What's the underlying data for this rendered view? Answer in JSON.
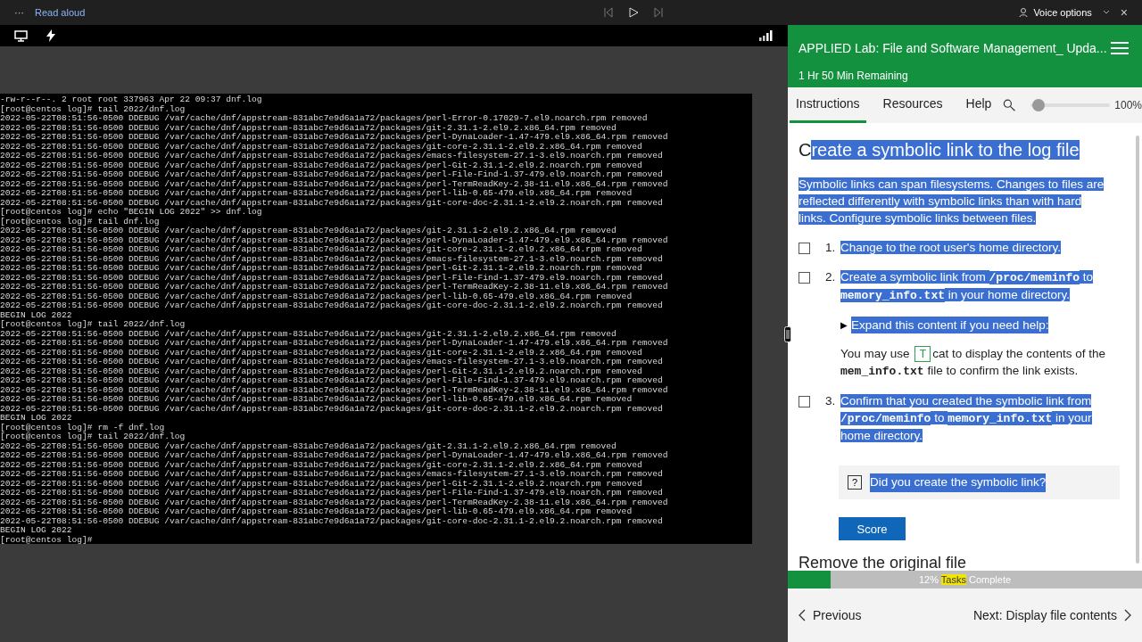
{
  "top_bar": {
    "more": "···",
    "read_aloud": "Read aloud",
    "voice_options": "Voice options",
    "close": "×"
  },
  "terminal": {
    "lines": [
      "-rw-r--r--. 2 root root 337963 Apr 22 09:37 dnf.log",
      "[root@centos log]# tail 2022/dnf.log",
      "2022-05-22T08:51:56-0500 DDEBUG /var/cache/dnf/appstream-831abc7e9d6a1a72/packages/perl-Error-0.17029-7.el9.noarch.rpm removed",
      "2022-05-22T08:51:56-0500 DDEBUG /var/cache/dnf/appstream-831abc7e9d6a1a72/packages/git-2.31.1-2.el9.2.x86_64.rpm removed",
      "2022-05-22T08:51:56-0500 DDEBUG /var/cache/dnf/appstream-831abc7e9d6a1a72/packages/perl-DynaLoader-1.47-479.el9.x86_64.rpm removed",
      "2022-05-22T08:51:56-0500 DDEBUG /var/cache/dnf/appstream-831abc7e9d6a1a72/packages/git-core-2.31.1-2.el9.2.x86_64.rpm removed",
      "2022-05-22T08:51:56-0500 DDEBUG /var/cache/dnf/appstream-831abc7e9d6a1a72/packages/emacs-filesystem-27.1-3.el9.noarch.rpm removed",
      "2022-05-22T08:51:56-0500 DDEBUG /var/cache/dnf/appstream-831abc7e9d6a1a72/packages/perl-Git-2.31.1-2.el9.2.noarch.rpm removed",
      "2022-05-22T08:51:56-0500 DDEBUG /var/cache/dnf/appstream-831abc7e9d6a1a72/packages/perl-File-Find-1.37-479.el9.noarch.rpm removed",
      "2022-05-22T08:51:56-0500 DDEBUG /var/cache/dnf/appstream-831abc7e9d6a1a72/packages/perl-TermReadKey-2.38-11.el9.x86_64.rpm removed",
      "2022-05-22T08:51:56-0500 DDEBUG /var/cache/dnf/appstream-831abc7e9d6a1a72/packages/perl-lib-0.65-479.el9.x86_64.rpm removed",
      "2022-05-22T08:51:56-0500 DDEBUG /var/cache/dnf/appstream-831abc7e9d6a1a72/packages/git-core-doc-2.31.1-2.el9.2.noarch.rpm removed",
      "[root@centos log]# echo \"BEGIN LOG 2022\" >> dnf.log",
      "[root@centos log]# tail dnf.log",
      "2022-05-22T08:51:56-0500 DDEBUG /var/cache/dnf/appstream-831abc7e9d6a1a72/packages/git-2.31.1-2.el9.2.x86_64.rpm removed",
      "2022-05-22T08:51:56-0500 DDEBUG /var/cache/dnf/appstream-831abc7e9d6a1a72/packages/perl-DynaLoader-1.47-479.el9.x86_64.rpm removed",
      "2022-05-22T08:51:56-0500 DDEBUG /var/cache/dnf/appstream-831abc7e9d6a1a72/packages/git-core-2.31.1-2.el9.2.x86_64.rpm removed",
      "2022-05-22T08:51:56-0500 DDEBUG /var/cache/dnf/appstream-831abc7e9d6a1a72/packages/emacs-filesystem-27.1-3.el9.noarch.rpm removed",
      "2022-05-22T08:51:56-0500 DDEBUG /var/cache/dnf/appstream-831abc7e9d6a1a72/packages/perl-Git-2.31.1-2.el9.2.noarch.rpm removed",
      "2022-05-22T08:51:56-0500 DDEBUG /var/cache/dnf/appstream-831abc7e9d6a1a72/packages/perl-File-Find-1.37-479.el9.noarch.rpm removed",
      "2022-05-22T08:51:56-0500 DDEBUG /var/cache/dnf/appstream-831abc7e9d6a1a72/packages/perl-TermReadKey-2.38-11.el9.x86_64.rpm removed",
      "2022-05-22T08:51:56-0500 DDEBUG /var/cache/dnf/appstream-831abc7e9d6a1a72/packages/perl-lib-0.65-479.el9.x86_64.rpm removed",
      "2022-05-22T08:51:56-0500 DDEBUG /var/cache/dnf/appstream-831abc7e9d6a1a72/packages/git-core-doc-2.31.1-2.el9.2.noarch.rpm removed",
      "BEGIN LOG 2022",
      "[root@centos log]# tail 2022/dnf.log",
      "2022-05-22T08:51:56-0500 DDEBUG /var/cache/dnf/appstream-831abc7e9d6a1a72/packages/git-2.31.1-2.el9.2.x86_64.rpm removed",
      "2022-05-22T08:51:56-0500 DDEBUG /var/cache/dnf/appstream-831abc7e9d6a1a72/packages/perl-DynaLoader-1.47-479.el9.x86_64.rpm removed",
      "2022-05-22T08:51:56-0500 DDEBUG /var/cache/dnf/appstream-831abc7e9d6a1a72/packages/git-core-2.31.1-2.el9.2.x86_64.rpm removed",
      "2022-05-22T08:51:56-0500 DDEBUG /var/cache/dnf/appstream-831abc7e9d6a1a72/packages/emacs-filesystem-27.1-3.el9.noarch.rpm removed",
      "2022-05-22T08:51:56-0500 DDEBUG /var/cache/dnf/appstream-831abc7e9d6a1a72/packages/perl-Git-2.31.1-2.el9.2.noarch.rpm removed",
      "2022-05-22T08:51:56-0500 DDEBUG /var/cache/dnf/appstream-831abc7e9d6a1a72/packages/perl-File-Find-1.37-479.el9.noarch.rpm removed",
      "2022-05-22T08:51:56-0500 DDEBUG /var/cache/dnf/appstream-831abc7e9d6a1a72/packages/perl-TermReadKey-2.38-11.el9.x86_64.rpm removed",
      "2022-05-22T08:51:56-0500 DDEBUG /var/cache/dnf/appstream-831abc7e9d6a1a72/packages/perl-lib-0.65-479.el9.x86_64.rpm removed",
      "2022-05-22T08:51:56-0500 DDEBUG /var/cache/dnf/appstream-831abc7e9d6a1a72/packages/git-core-doc-2.31.1-2.el9.2.noarch.rpm removed",
      "BEGIN LOG 2022",
      "[root@centos log]# rm -f dnf.log",
      "[root@centos log]# tail 2022/dnf.log",
      "2022-05-22T08:51:56-0500 DDEBUG /var/cache/dnf/appstream-831abc7e9d6a1a72/packages/git-2.31.1-2.el9.2.x86_64.rpm removed",
      "2022-05-22T08:51:56-0500 DDEBUG /var/cache/dnf/appstream-831abc7e9d6a1a72/packages/perl-DynaLoader-1.47-479.el9.x86_64.rpm removed",
      "2022-05-22T08:51:56-0500 DDEBUG /var/cache/dnf/appstream-831abc7e9d6a1a72/packages/git-core-2.31.1-2.el9.2.x86_64.rpm removed",
      "2022-05-22T08:51:56-0500 DDEBUG /var/cache/dnf/appstream-831abc7e9d6a1a72/packages/emacs-filesystem-27.1-3.el9.noarch.rpm removed",
      "2022-05-22T08:51:56-0500 DDEBUG /var/cache/dnf/appstream-831abc7e9d6a1a72/packages/perl-Git-2.31.1-2.el9.2.noarch.rpm removed",
      "2022-05-22T08:51:56-0500 DDEBUG /var/cache/dnf/appstream-831abc7e9d6a1a72/packages/perl-File-Find-1.37-479.el9.noarch.rpm removed",
      "2022-05-22T08:51:56-0500 DDEBUG /var/cache/dnf/appstream-831abc7e9d6a1a72/packages/perl-TermReadKey-2.38-11.el9.x86_64.rpm removed",
      "2022-05-22T08:51:56-0500 DDEBUG /var/cache/dnf/appstream-831abc7e9d6a1a72/packages/perl-lib-0.65-479.el9.x86_64.rpm removed",
      "2022-05-22T08:51:56-0500 DDEBUG /var/cache/dnf/appstream-831abc7e9d6a1a72/packages/git-core-doc-2.31.1-2.el9.2.noarch.rpm removed",
      "BEGIN LOG 2022",
      "[root@centos log]#"
    ]
  },
  "lab": {
    "title": "APPLIED Lab: File and Software Management_ Upda...",
    "remaining": "1 Hr 50 Min Remaining",
    "tabs": [
      {
        "label": "Instructions",
        "selected": true
      },
      {
        "label": "Resources",
        "selected": false
      },
      {
        "label": "Help",
        "selected": false
      }
    ],
    "zoom": {
      "level": 0.03,
      "reading": "100%"
    },
    "heading": [
      {
        "text": "C",
        "highlighted": false
      },
      {
        "text": "reate a symbolic link to the log file",
        "highlighted": true
      }
    ],
    "intro": "Symbolic links can span filesystems. Changes to files are reflected differently with symbolic links than with hard links. Configure symbolic links between files.",
    "steps": [
      {
        "number": "1.",
        "checked": false,
        "parts": [
          {
            "text": "Change to the root user's home directory."
          }
        ]
      },
      {
        "number": "2.",
        "checked": false,
        "parts": [
          {
            "text": "Create a symbolic link from "
          },
          {
            "text": "/proc/meminfo",
            "code": true
          },
          {
            "text": " to "
          },
          {
            "text": "memory_info.txt",
            "code": true
          },
          {
            "text": " in your home directory."
          }
        ],
        "help": {
          "expander_icon": "▶",
          "expander": "Expand this content if you need help:",
          "parts": [
            {
              "text": "You may use "
            },
            {
              "text": "T",
              "kind": "type-button"
            },
            {
              "text": "cat to display the contents of the "
            },
            {
              "text": "mem_info.txt",
              "code": true
            },
            {
              "text": " file to confirm the link exists."
            }
          ]
        }
      },
      {
        "number": "3.",
        "checked": false,
        "parts": [
          {
            "text": "Confirm that you created the symbolic link from "
          },
          {
            "text": "/proc/meminfo",
            "code": true
          },
          {
            "text": " to "
          },
          {
            "text": "memory_info.txt",
            "code": true
          },
          {
            "text": " in your home directory."
          }
        ]
      }
    ],
    "question": {
      "icon": "?",
      "text": "Did you create the symbolic link?"
    },
    "score": "Score",
    "next_heading": "Remove the original file",
    "progress": {
      "level": 0.12,
      "percent": "12%",
      "tasks": "Tasks",
      "complete": "Complete"
    },
    "previous": "Previous",
    "next": "Next: Display file contents"
  }
}
